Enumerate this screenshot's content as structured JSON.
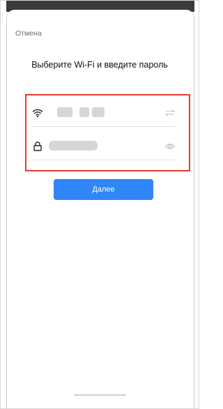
{
  "header": {
    "cancel_label": "Отмена"
  },
  "main": {
    "title": "Выберите Wi-Fi и введите пароль",
    "next_button_label": "Далее"
  },
  "form": {
    "wifi_row": {
      "lead_icon": "wifi-icon",
      "trail_icon": "switch-network-icon",
      "value_blurred": true
    },
    "password_row": {
      "lead_icon": "lock-icon",
      "trail_icon": "eye-icon",
      "value_blurred": true
    }
  },
  "colors": {
    "accent": "#2f86f6",
    "highlight": "#e23b2e"
  }
}
